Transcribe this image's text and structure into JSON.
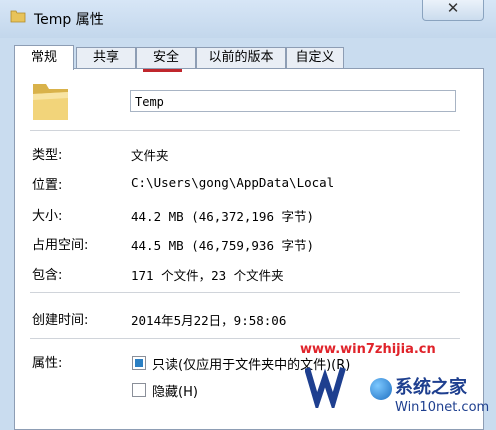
{
  "window": {
    "title": "Temp 属性",
    "close_glyph": "✕"
  },
  "tabs": [
    {
      "label": "常规",
      "active": true
    },
    {
      "label": "共享",
      "active": false
    },
    {
      "label": "安全",
      "active": false
    },
    {
      "label": "以前的版本",
      "active": false
    },
    {
      "label": "自定义",
      "active": false
    }
  ],
  "general": {
    "name_value": "Temp",
    "rows": {
      "type": {
        "label": "类型:",
        "value": "文件夹"
      },
      "location": {
        "label": "位置:",
        "value": "C:\\Users\\gong\\AppData\\Local"
      },
      "size": {
        "label": "大小:",
        "value": "44.2 MB (46,372,196 字节)"
      },
      "size_on_disk": {
        "label": "占用空间:",
        "value": "44.5 MB (46,759,936 字节)"
      },
      "contains": {
        "label": "包含:",
        "value": "171 个文件，23 个文件夹"
      },
      "created": {
        "label": "创建时间:",
        "value": "2014年5月22日，9:58:06"
      }
    },
    "attributes": {
      "label": "属性:",
      "readonly": {
        "label": "只读(仅应用于文件夹中的文件)(R)",
        "checked": "indeterminate"
      },
      "hidden": {
        "label": "隐藏(H)",
        "checked": false
      }
    }
  },
  "watermarks": {
    "site1": "www.win7zhijia.cn",
    "site2_name": "系统之家",
    "site2_url": "Win10net.com"
  },
  "colors": {
    "accent_underline": "#c0262c",
    "checkbox_fill": "#2b7fc3"
  }
}
